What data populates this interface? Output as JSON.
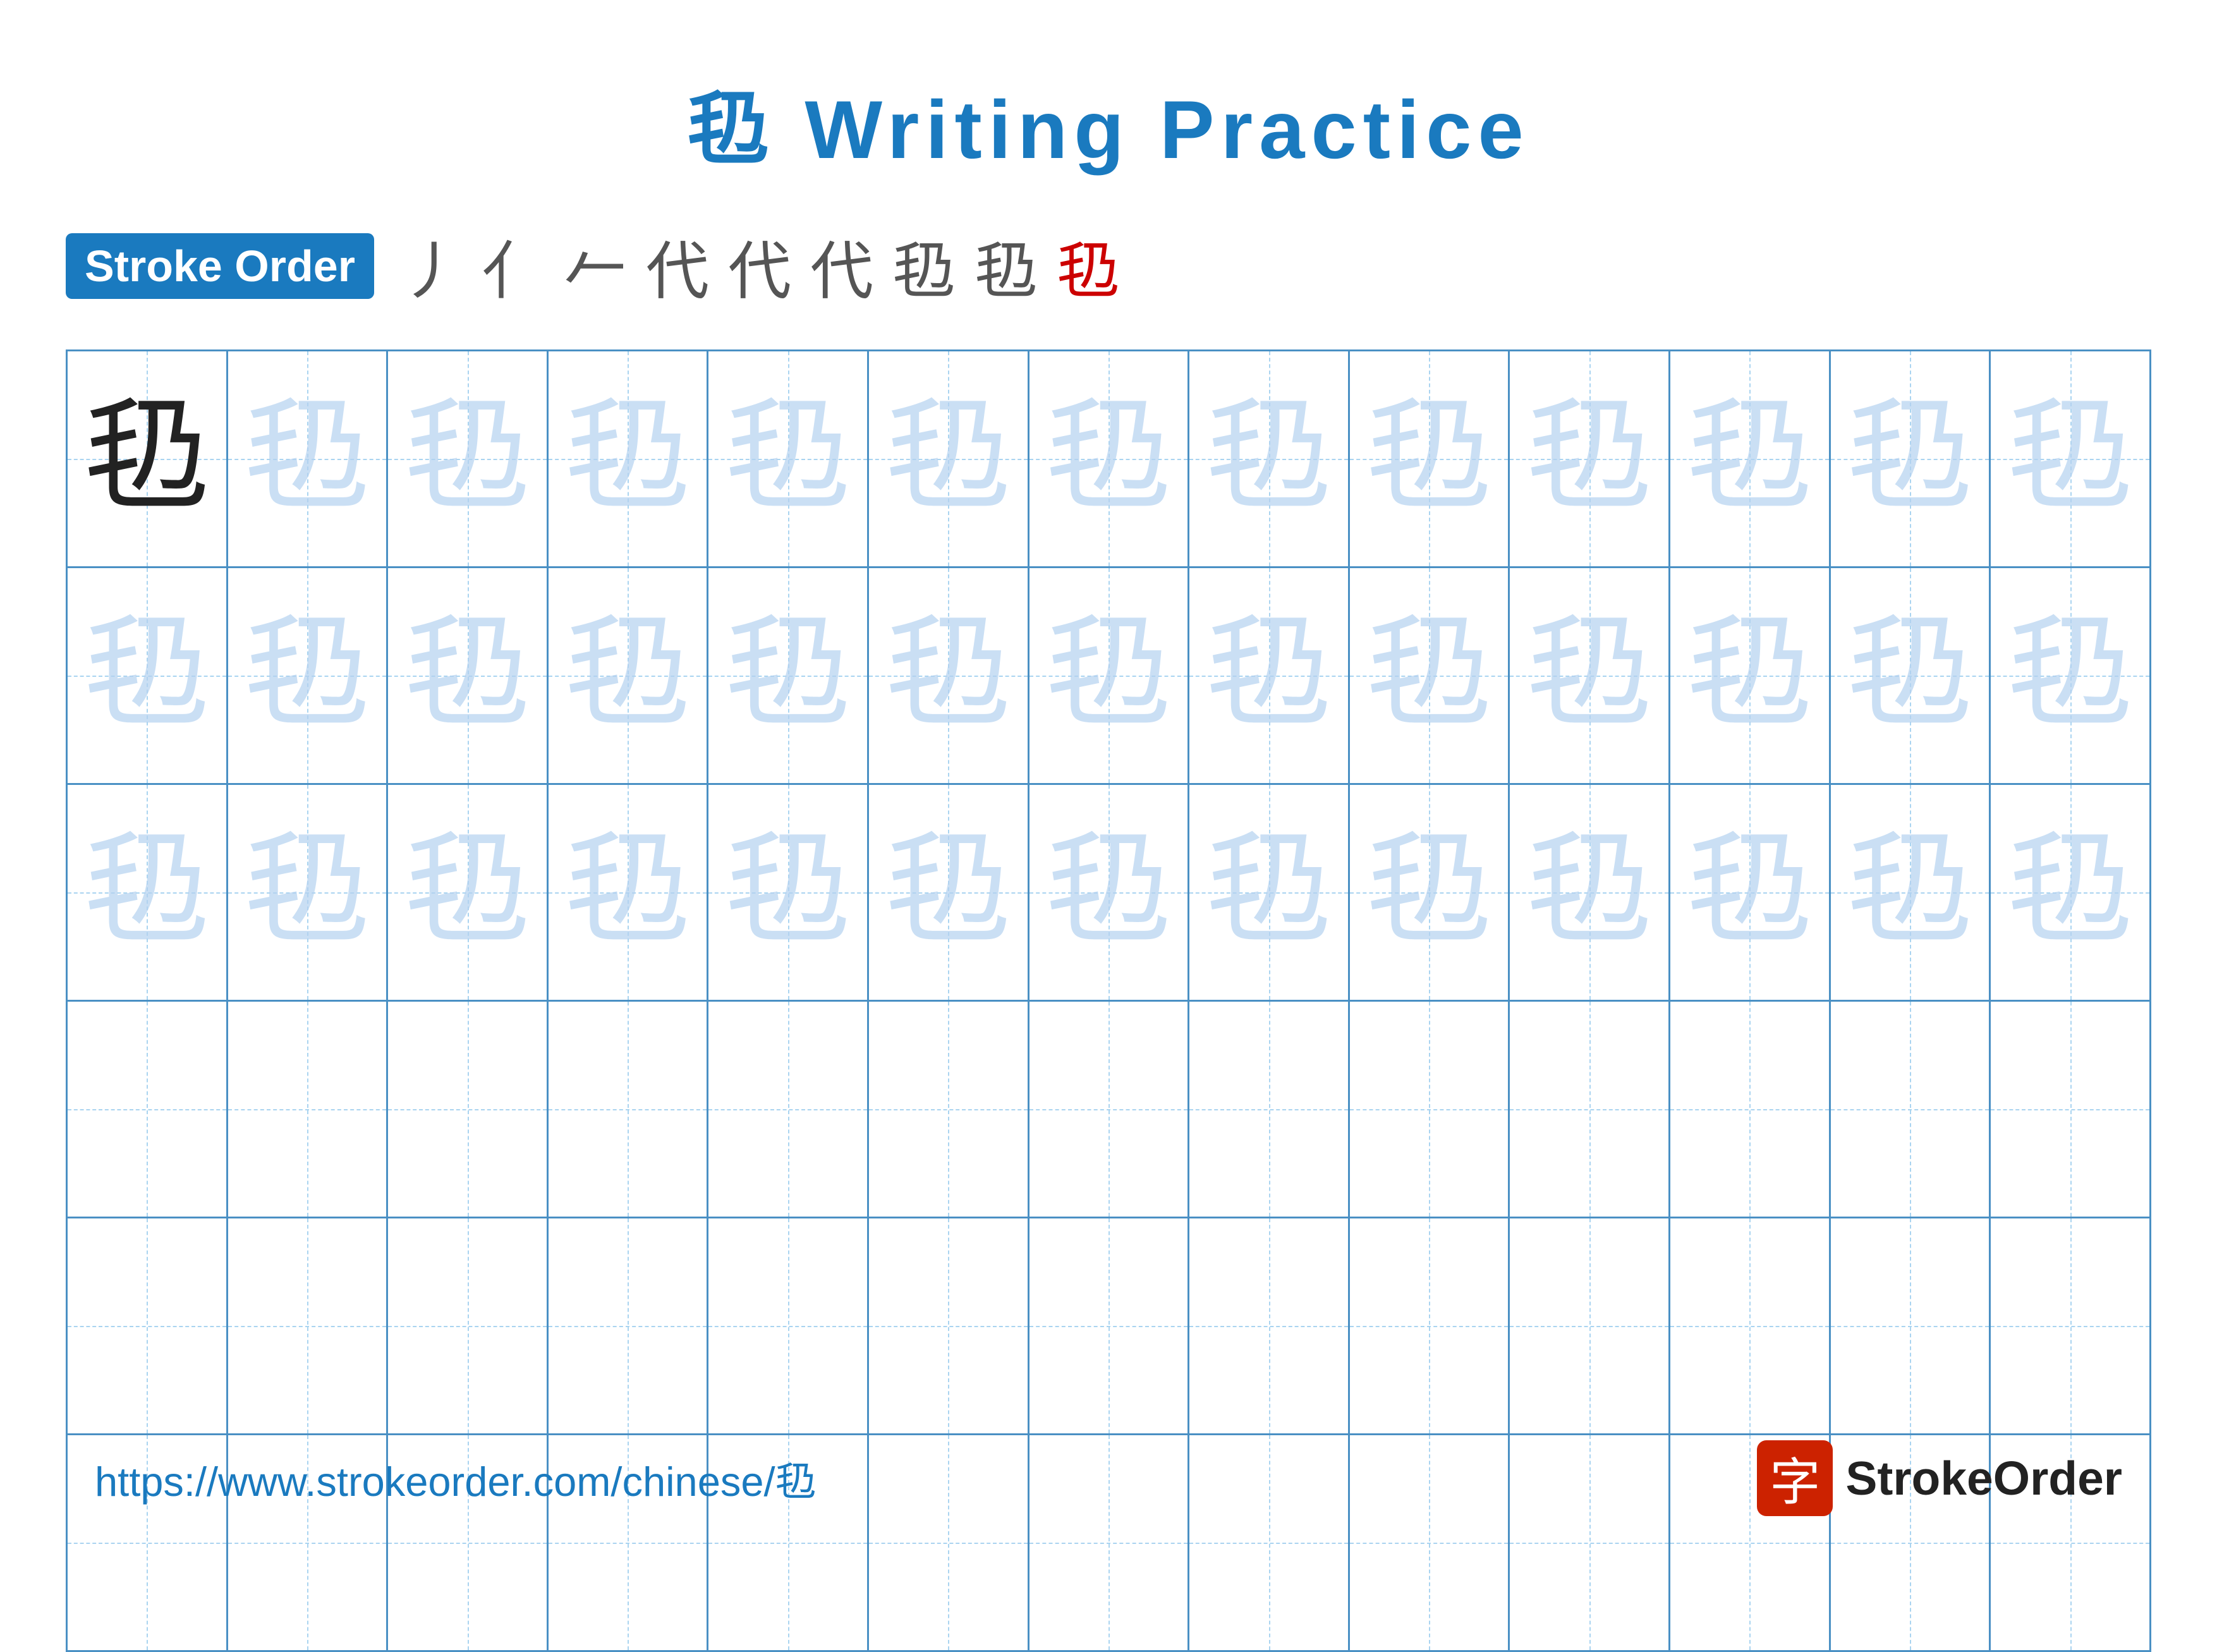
{
  "page": {
    "title": "㲌 Writing Practice",
    "character": "㲌"
  },
  "stroke_order": {
    "badge_label": "Stroke Order",
    "steps": [
      "丿",
      "亻",
      "𠂉",
      "代",
      "代",
      "代",
      "㲌",
      "㲌",
      "㲌"
    ]
  },
  "grid": {
    "rows": 6,
    "cols": 13,
    "filled_rows": 3,
    "character": "㲌"
  },
  "footer": {
    "url": "https://www.strokeorder.com/chinese/㲌",
    "logo_char": "字",
    "logo_text": "StrokeOrder"
  }
}
